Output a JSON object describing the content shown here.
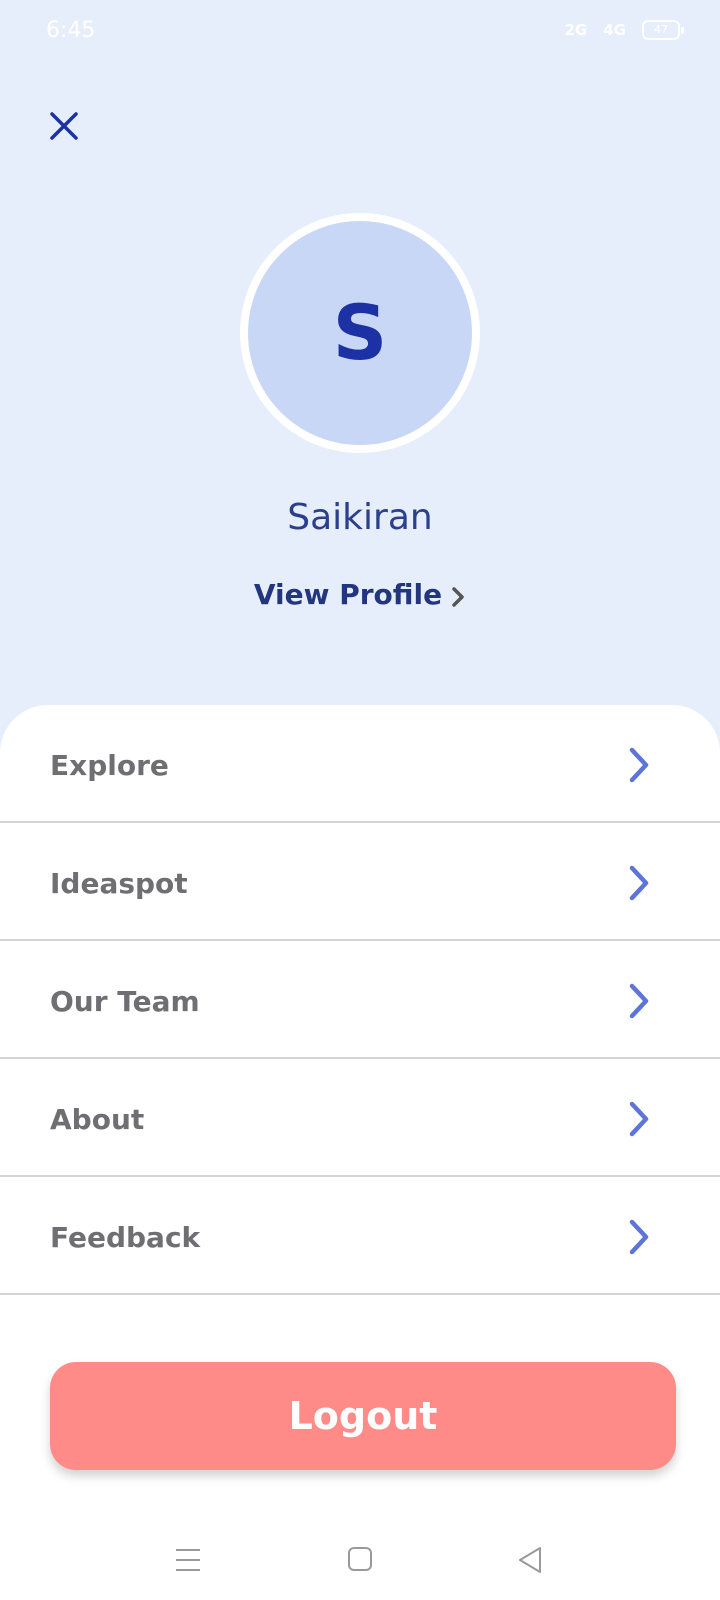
{
  "status_bar": {
    "time": "6:45",
    "network_1": "2G",
    "network_2": "4G",
    "battery": "47"
  },
  "icons": {
    "close": "close-icon",
    "chevron": "chevron-right-icon",
    "menu": "menu-icon",
    "home": "home-icon",
    "back": "back-icon"
  },
  "profile": {
    "initial": "S",
    "name": "Saikiran",
    "view_profile_label": "View Profile"
  },
  "menu": {
    "items": [
      {
        "label": "Explore"
      },
      {
        "label": "Ideaspot"
      },
      {
        "label": "Our Team"
      },
      {
        "label": "About"
      },
      {
        "label": "Feedback"
      }
    ]
  },
  "logout": {
    "label": "Logout"
  },
  "colors": {
    "header_bg": "#e6eefc",
    "avatar_bg": "#c9d7f7",
    "accent": "#5d74d9",
    "logout_bg": "#ff8b88",
    "text_dark_blue": "#22367e"
  }
}
